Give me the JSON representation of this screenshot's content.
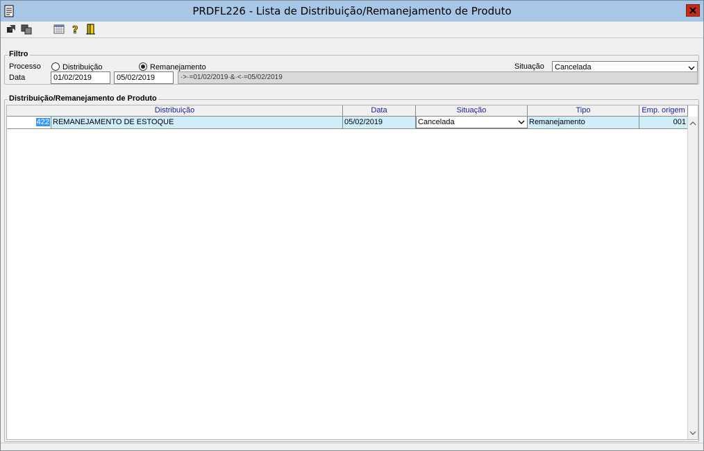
{
  "window": {
    "title": "PRDFL226 - Lista de Distribuição/Remanejamento de Produto"
  },
  "toolbar": {
    "buttons": [
      {
        "icon": "arrow-export-icon"
      },
      {
        "icon": "copy-windows-icon"
      },
      {
        "icon": "calendar-grid-icon"
      },
      {
        "icon": "help-icon"
      },
      {
        "icon": "exit-door-icon"
      }
    ]
  },
  "filter": {
    "legend": "Filtro",
    "processo_label": "Processo",
    "radio_distribuicao": "Distribuição",
    "radio_remanejamento": "Remanejamento",
    "selected_process": "Remanejamento",
    "data_label": "Data",
    "date_from": "01/02/2019",
    "date_to": "05/02/2019",
    "expression": "·>·=01/02/2019·&·<·=05/02/2019",
    "situacao_label": "Situação",
    "situacao_value": "Cancelada"
  },
  "list": {
    "legend": "Distribuição/Remanejamento de Produto",
    "columns": [
      "Distribuição",
      "Data",
      "Situação",
      "Tipo",
      "Emp. origem"
    ],
    "rows": [
      {
        "id": "422",
        "distribuicao": "REMANEJAMENTO DE ESTOQUE",
        "data": "05/02/2019",
        "situacao": "Cancelada",
        "tipo": "Remanejamento",
        "emp_origem": "001"
      }
    ]
  },
  "colors": {
    "titlebar": "#a8c6e6",
    "close_button": "#c42b1c",
    "header_text": "#1c1c9c",
    "selected_row": "#cfeef8",
    "selection": "#3399ff"
  }
}
